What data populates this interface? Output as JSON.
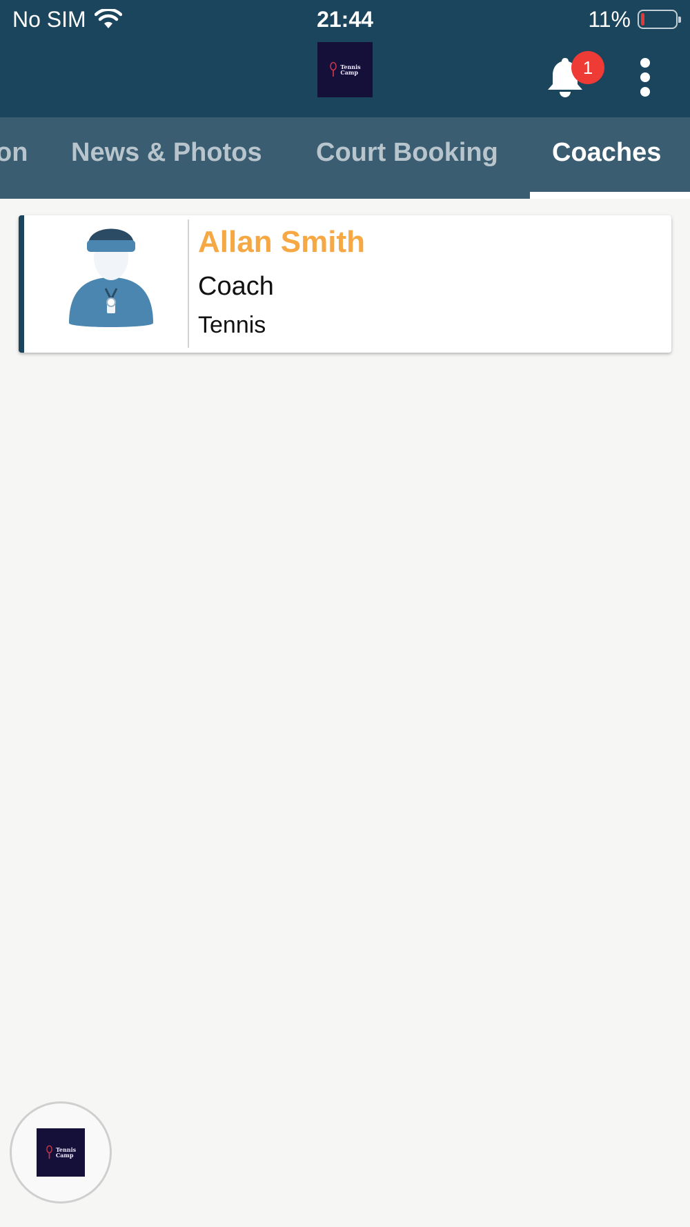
{
  "status_bar": {
    "carrier": "No SIM",
    "time": "21:44",
    "battery": "11%",
    "battery_level": 0.11,
    "battery_color": "#e53935",
    "wifi_icon": "wifi-icon"
  },
  "header": {
    "logo_text_line1": "Tennis",
    "logo_text_line2": "Camp",
    "notification_count": "1",
    "bell_icon": "bell-icon",
    "more_icon": "more-vertical-icon",
    "background_color": "#1b455c"
  },
  "tabs": [
    {
      "label": "on",
      "active": false
    },
    {
      "label": "News & Photos",
      "active": false
    },
    {
      "label": "Court Booking",
      "active": false
    },
    {
      "label": "Coaches",
      "active": true
    }
  ],
  "coaches": [
    {
      "name": "Allan Smith",
      "role": "Coach",
      "sport": "Tennis",
      "avatar_icon": "coach-avatar-icon"
    }
  ],
  "fab": {
    "logo_text_line1": "Tennis",
    "logo_text_line2": "Camp"
  },
  "colors": {
    "accent_name": "#f5a843",
    "tabbar": "#3a5d72",
    "badge": "#ef3b36"
  }
}
